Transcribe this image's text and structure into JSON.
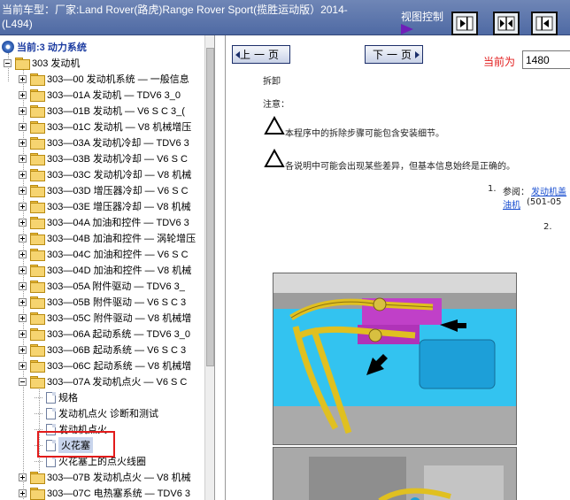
{
  "header": {
    "car_title": "当前车型：厂家:Land Rover(路虎)Range Rover Sport(揽胜运动版）2014-(L494)",
    "view_control_label": "视图控制",
    "view_buttons": [
      "right-panel-icon",
      "split-view-icon",
      "left-panel-icon"
    ]
  },
  "tree": {
    "root_label": "当前:3 动力系统",
    "items": [
      {
        "label": "303 发动机",
        "type": "folder",
        "expanded": true
      },
      {
        "label": "303—00 发动机系统 — 一般信息",
        "type": "folder"
      },
      {
        "label": "303—01A 发动机 — TDV6 3_0",
        "type": "folder"
      },
      {
        "label": "303—01B 发动机 — V6 S C 3_(",
        "type": "folder"
      },
      {
        "label": "303—01C 发动机 — V8 机械增压",
        "type": "folder"
      },
      {
        "label": "303—03A 发动机冷却 — TDV6 3",
        "type": "folder"
      },
      {
        "label": "303—03B 发动机冷却 — V6 S C",
        "type": "folder"
      },
      {
        "label": "303—03C 发动机冷却 — V8 机械",
        "type": "folder"
      },
      {
        "label": "303—03D 增压器冷却 — V6 S C",
        "type": "folder"
      },
      {
        "label": "303—03E 增压器冷却 — V8 机械",
        "type": "folder"
      },
      {
        "label": "303—04A 加油和控件 — TDV6 3",
        "type": "folder"
      },
      {
        "label": "303—04B 加油和控件 — 涡轮增压",
        "type": "folder"
      },
      {
        "label": "303—04C 加油和控件 — V6 S C",
        "type": "folder"
      },
      {
        "label": "303—04D 加油和控件 — V8 机械",
        "type": "folder"
      },
      {
        "label": "303—05A 附件驱动 — TDV6 3_",
        "type": "folder"
      },
      {
        "label": "303—05B 附件驱动 — V6 S C 3",
        "type": "folder"
      },
      {
        "label": "303—05C 附件驱动 — V8 机械增",
        "type": "folder"
      },
      {
        "label": "303—06A 起动系统 — TDV6 3_0",
        "type": "folder"
      },
      {
        "label": "303—06B 起动系统 — V6 S C 3",
        "type": "folder"
      },
      {
        "label": "303—06C 起动系统 — V8 机械增",
        "type": "folder"
      },
      {
        "label": "303—07A 发动机点火 — V6 S C",
        "type": "folder",
        "expanded": true
      },
      {
        "label": "规格",
        "type": "doc"
      },
      {
        "label": "发动机点火 诊断和测试",
        "type": "doc"
      },
      {
        "label": "发动机点火",
        "type": "doc"
      },
      {
        "label": "火花塞",
        "type": "doc",
        "selected": true
      },
      {
        "label": "火花塞上的点火线圈",
        "type": "doc"
      },
      {
        "label": "303—07B 发动机点火 — V8 机械",
        "type": "folder"
      },
      {
        "label": "303—07C 电热塞系统 — TDV6 3",
        "type": "folder"
      }
    ]
  },
  "nav": {
    "prev_label": "上一页",
    "next_label": "下一页",
    "current_page_label": "当前为",
    "current_page_value": "1480"
  },
  "content": {
    "heading": "拆卸",
    "note_label": "注意：",
    "note1": "本程序中的拆除步骤可能包含安装细节。",
    "note2": "各说明中可能会出现某些差异，但基本信息始终是正确的。",
    "step1_num": "1.",
    "step1_prefix": "参阅：",
    "step1_link": "发动机盖",
    "step1_link2": "油机",
    "step1_suffix": "(501-05",
    "step2_num": "2."
  },
  "colors": {
    "header_bg": "#5b74ac",
    "accent_red": "#e21b1b",
    "link_blue": "#1a4fd0",
    "selection": "#c8d4ec"
  }
}
